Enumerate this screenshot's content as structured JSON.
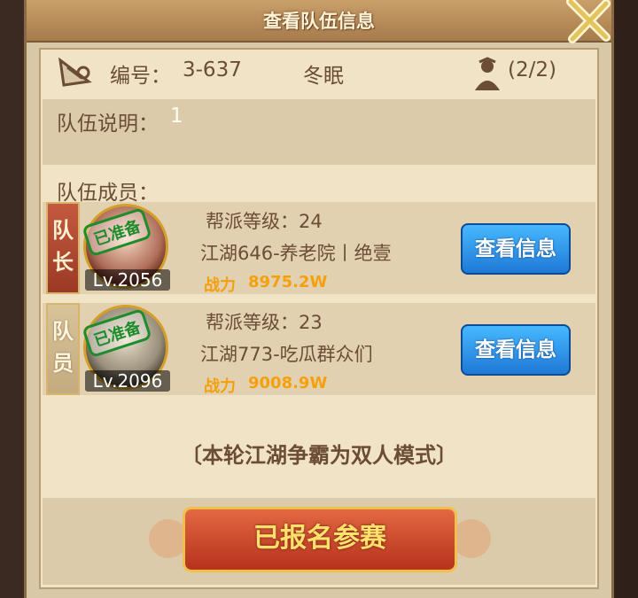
{
  "window": {
    "title": "查看队伍信息"
  },
  "team": {
    "code_label": "编号：",
    "code_value": "3-637",
    "name": "冬眠",
    "member_count": "(2/2)",
    "desc_label": "队伍说明：",
    "desc_value": "1",
    "members_label": "队伍成员："
  },
  "members": [
    {
      "role": "队长",
      "stamp": "已准备",
      "level": "Lv.2056",
      "guild_level": "帮派等级：24",
      "server": "江湖646-养老院丨绝壹",
      "power_label": "战力",
      "power_value": "8975.2W",
      "view_label": "查看信息"
    },
    {
      "role": "队员",
      "stamp": "已准备",
      "level": "Lv.2096",
      "guild_level": "帮派等级：23",
      "server": "江湖773-吃瓜群众们",
      "power_label": "战力",
      "power_value": "9008.9W",
      "view_label": "查看信息"
    }
  ],
  "mode_text": "〔本轮江湖争霸为双人模式〕",
  "action": {
    "signed_label": "已报名参赛"
  },
  "colors": {
    "panel_bg": "#f1e4c6",
    "text_brown": "#6b4c37",
    "power_orange": "#f5a00a",
    "button_blue": "#1f79d6",
    "button_red": "#b5321d"
  },
  "icons": [
    "team-flag-icon",
    "person-icon",
    "close-icon"
  ]
}
